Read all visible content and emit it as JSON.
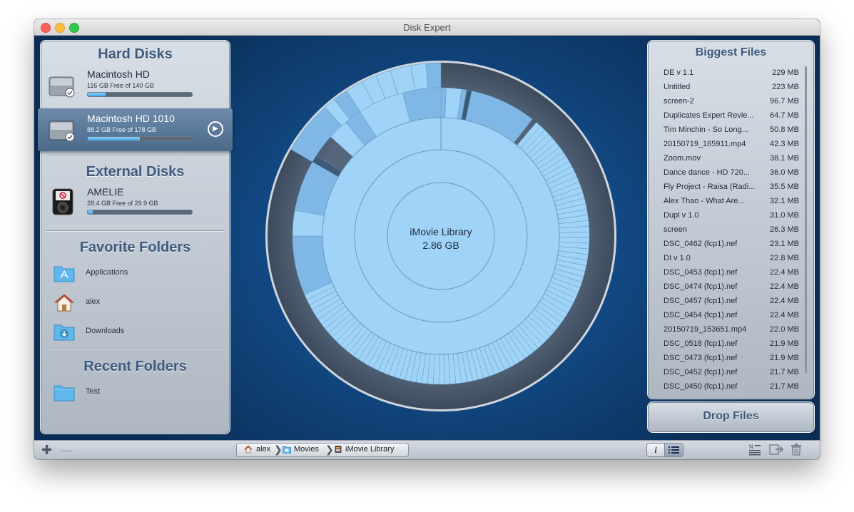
{
  "window": {
    "title": "Disk Expert"
  },
  "sections": {
    "hard_disks": "Hard Disks",
    "external_disks": "External Disks",
    "favorite_folders": "Favorite Folders",
    "recent_folders": "Recent Folders"
  },
  "hard_disks": [
    {
      "name": "Macintosh HD",
      "free": "116 GB Free of 140 GB",
      "used_fraction": 0.17,
      "selected": false
    },
    {
      "name": "Macintosh HD 1010",
      "free": "88.2 GB Free of 178 GB",
      "used_fraction": 0.5,
      "selected": true
    }
  ],
  "external_disks": [
    {
      "name": "AMELIE",
      "free": "28.4 GB Free of 29.9 GB",
      "used_fraction": 0.05
    }
  ],
  "favorite_folders": [
    {
      "label": "Applications",
      "icon": "applications-folder-icon"
    },
    {
      "label": "alex",
      "icon": "home-icon"
    },
    {
      "label": "Downloads",
      "icon": "downloads-folder-icon"
    }
  ],
  "recent_folders": [
    {
      "label": "Test",
      "icon": "folder-icon"
    }
  ],
  "center": {
    "name": "iMovie Library",
    "size": "2.86 GB"
  },
  "biggest_files": {
    "title": "Biggest Files",
    "files": [
      {
        "name": "DE v 1.1",
        "size": "229 MB"
      },
      {
        "name": "Untitled",
        "size": "223 MB"
      },
      {
        "name": "screen-2",
        "size": "96.7 MB"
      },
      {
        "name": "Duplicates Expert Revie...",
        "size": "64.7 MB"
      },
      {
        "name": "Tim Minchin - So Long...",
        "size": "50.8 MB"
      },
      {
        "name": "20150719_165911.mp4",
        "size": "42.3 MB"
      },
      {
        "name": "Zoom.mov",
        "size": "38.1 MB"
      },
      {
        "name": "Dance dance - HD 720...",
        "size": "36.0 MB"
      },
      {
        "name": "Fly Project - Raisa (Radi...",
        "size": "35.5 MB"
      },
      {
        "name": "Alex Thao - What Are...",
        "size": "32.1 MB"
      },
      {
        "name": "Dupl v 1.0",
        "size": "31.0 MB"
      },
      {
        "name": "screen",
        "size": "26.3 MB"
      },
      {
        "name": "DSC_0462 (fcp1).nef",
        "size": "23.1 MB"
      },
      {
        "name": "DI v 1.0",
        "size": "22.8 MB"
      },
      {
        "name": "DSC_0453 (fcp1).nef",
        "size": "22.4 MB"
      },
      {
        "name": "DSC_0474 (fcp1).nef",
        "size": "22.4 MB"
      },
      {
        "name": "DSC_0457 (fcp1).nef",
        "size": "22.4 MB"
      },
      {
        "name": "DSC_0454 (fcp1).nef",
        "size": "22.4 MB"
      },
      {
        "name": "20150719_153651.mp4",
        "size": "22.0 MB"
      },
      {
        "name": "DSC_0518 (fcp1).nef",
        "size": "21.9 MB"
      },
      {
        "name": "DSC_0473 (fcp1).nef",
        "size": "21.9 MB"
      },
      {
        "name": "DSC_0452 (fcp1).nef",
        "size": "21.7 MB"
      },
      {
        "name": "DSC_0450 (fcp1).nef",
        "size": "21.7 MB"
      }
    ]
  },
  "drop_files": {
    "label": "Drop Files"
  },
  "path_bar": [
    {
      "label": "alex",
      "icon": "home-icon"
    },
    {
      "label": "Movies",
      "icon": "movies-folder-icon"
    },
    {
      "label": "iMovie Library",
      "icon": "imovie-library-icon"
    }
  ],
  "toolbar": {
    "add_icon": "plus-icon",
    "remove_icon": "minus-icon",
    "info_label": "i",
    "sort_icon": "sort-icon",
    "export_icon": "export-icon",
    "trash_icon": "trash-icon"
  },
  "colors": {
    "section_title": "#3f5a7d",
    "chart_light": "#9fd3f7",
    "chart_mid": "#7fb8e6",
    "chart_outer": "#4a5a6e",
    "usage_bar": "#3aa4e6"
  }
}
